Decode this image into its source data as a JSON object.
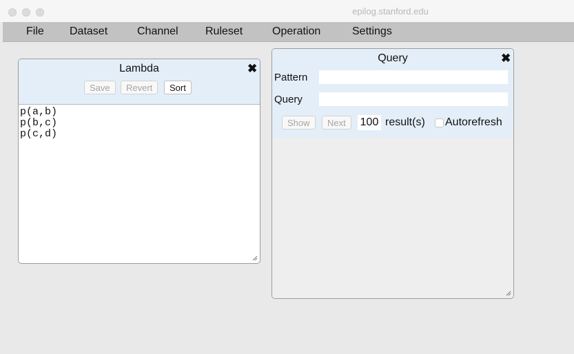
{
  "window": {
    "title": "epilog.stanford.edu"
  },
  "menubar": {
    "items": [
      "File",
      "Dataset",
      "Channel",
      "Ruleset",
      "Operation",
      "Settings"
    ]
  },
  "lambda_panel": {
    "title": "Lambda",
    "close_icon": "close-icon",
    "buttons": {
      "save": "Save",
      "revert": "Revert",
      "sort": "Sort"
    },
    "content_lines": [
      "p(a,b)",
      "p(b,c)",
      "p(c,d)"
    ]
  },
  "query_panel": {
    "title": "Query",
    "close_icon": "close-icon",
    "pattern_label": "Pattern",
    "pattern_value": "",
    "query_label": "Query",
    "query_value": "",
    "buttons": {
      "show": "Show",
      "next": "Next"
    },
    "result_count": "100",
    "results_label": "result(s)",
    "autorefresh_label": "Autorefresh",
    "autorefresh_checked": false
  },
  "colors": {
    "menubar_bg": "#c2c2c2",
    "panel_header_bg": "#e4eef8",
    "window_bg": "#e9e9e9",
    "results_bg": "#eeeeee"
  }
}
